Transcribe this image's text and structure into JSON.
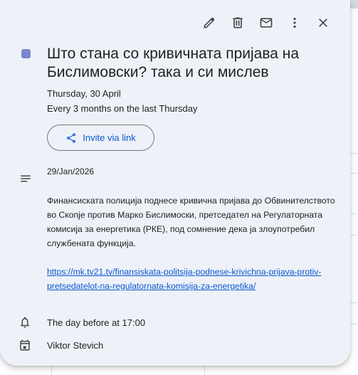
{
  "toolbar": {
    "edit_icon": "pencil-icon",
    "delete_icon": "trash-icon",
    "email_icon": "mail-icon",
    "more_icon": "more-vert-icon",
    "close_icon": "close-icon"
  },
  "event": {
    "color": "#7986cb",
    "title": "Што стана со кривичната пријава на Бислимовски? така и си мислев",
    "date": "Thursday, 30 April",
    "recurrence": "Every 3 months on the last Thursday",
    "invite_label": "Invite via link"
  },
  "description": {
    "date": "29/Jan/2026",
    "body": "Финансиската полиција поднесе кривична пријава до Обвинителството во Скопје против Марко Бислимоски, претседател на Регулаторната комисија за енергетика (РКЕ), под сомнение дека ја злоупотребил службената функција.",
    "link": "https://mk.tv21.tv/finansiskata-politsija-podnese-krivichna-prijava-protiv-pretsedatelot-na-regulatornata-komisija-za-energetika/"
  },
  "notification": {
    "text": "The day before at 17:00"
  },
  "calendar": {
    "owner": "Viktor Stevich"
  },
  "colors": {
    "card_bg": "#eef2f8",
    "accent": "#0b57d0"
  }
}
